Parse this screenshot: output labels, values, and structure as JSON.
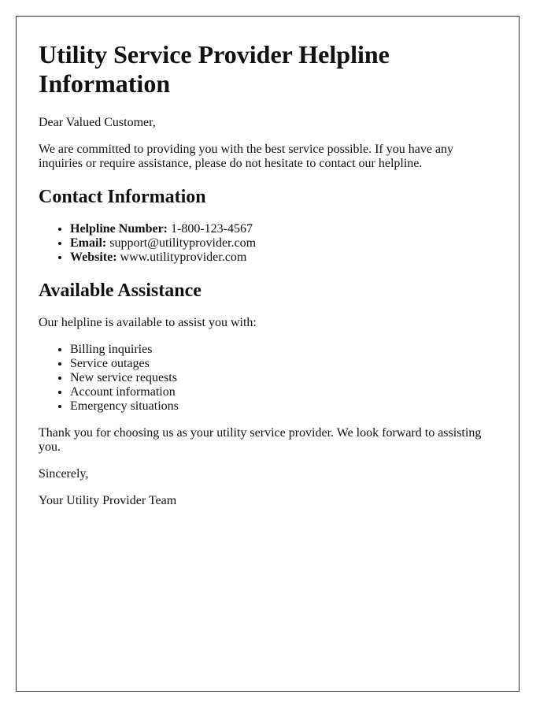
{
  "title": "Utility Service Provider Helpline Information",
  "greeting": "Dear Valued Customer,",
  "intro": "We are committed to providing you with the best service possible. If you have any inquiries or require assistance, please do not hesitate to contact our helpline.",
  "contact": {
    "heading": "Contact Information",
    "items": [
      {
        "label": "Helpline Number:",
        "value": "1-800-123-4567"
      },
      {
        "label": "Email:",
        "value": "support@utilityprovider.com"
      },
      {
        "label": "Website:",
        "value": "www.utilityprovider.com"
      }
    ]
  },
  "assistance": {
    "heading": "Available Assistance",
    "intro": "Our helpline is available to assist you with:",
    "items": [
      "Billing inquiries",
      "Service outages",
      "New service requests",
      "Account information",
      "Emergency situations"
    ]
  },
  "closing": "Thank you for choosing us as your utility service provider. We look forward to assisting you.",
  "signoff": "Sincerely,",
  "signature": "Your Utility Provider Team"
}
